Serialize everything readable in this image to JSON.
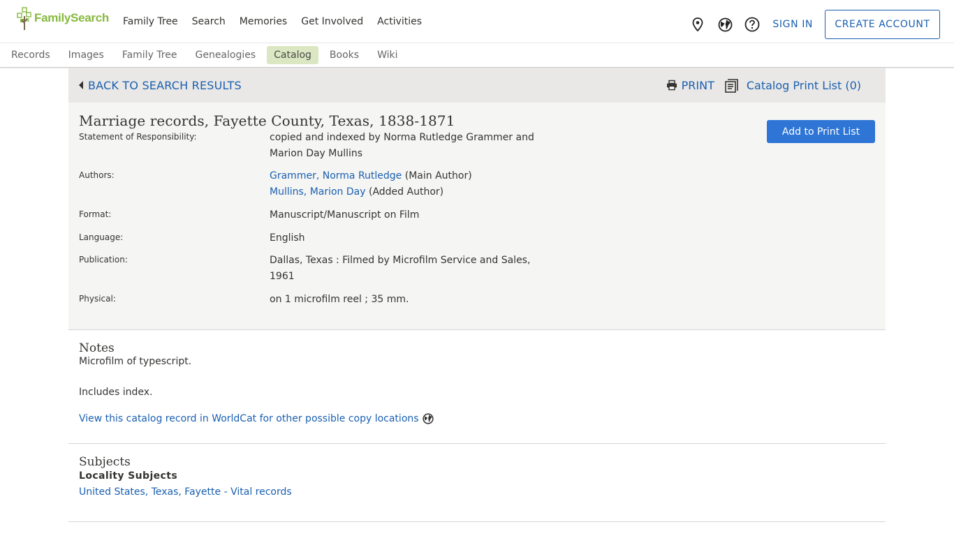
{
  "header": {
    "logo_text": "FamilySearch",
    "nav": [
      "Family Tree",
      "Search",
      "Memories",
      "Get Involved",
      "Activities"
    ],
    "sign_in": "SIGN IN",
    "create_account": "CREATE ACCOUNT",
    "icons": [
      "location-pin-icon",
      "globe-icon",
      "help-icon"
    ]
  },
  "subnav": {
    "items": [
      "Records",
      "Images",
      "Family Tree",
      "Genealogies",
      "Catalog",
      "Books",
      "Wiki"
    ],
    "active": "Catalog"
  },
  "backbar": {
    "back_label": "BACK TO SEARCH RESULTS",
    "print_label": "PRINT",
    "print_list_label": "Catalog Print List (0)"
  },
  "record": {
    "title": "Marriage records, Fayette County, Texas, 1838-1871",
    "add_button": "Add to Print List",
    "fields": {
      "responsibility_label": "Statement of Responsibility:",
      "responsibility_value": "copied and indexed by Norma Rutledge Grammer and Marion Day Mullins",
      "authors_label": "Authors:",
      "author1_name": "Grammer, Norma Rutledge",
      "author1_role": "(Main Author)",
      "author2_name": "Mullins, Marion Day",
      "author2_role": "(Added Author)",
      "format_label": "Format:",
      "format_value": "Manuscript/Manuscript on Film",
      "language_label": "Language:",
      "language_value": "English",
      "publication_label": "Publication:",
      "publication_value": "Dallas, Texas : Filmed by Microfilm Service and Sales, 1961",
      "physical_label": "Physical:",
      "physical_value": "on 1 microfilm reel ; 35 mm."
    }
  },
  "notes": {
    "title": "Notes",
    "line1": "Microfilm of typescript.",
    "line2": "Includes index.",
    "worldcat_link": "View this catalog record in WorldCat for other possible copy locations"
  },
  "subjects": {
    "title": "Subjects",
    "locality_heading": "Locality Subjects",
    "locality_link": "United States, Texas, Fayette - Vital records"
  },
  "colors": {
    "link": "#1a5fb0",
    "brand_green": "#87b93e",
    "button_blue": "#2e75d6",
    "active_tab": "#dbe7c2"
  }
}
